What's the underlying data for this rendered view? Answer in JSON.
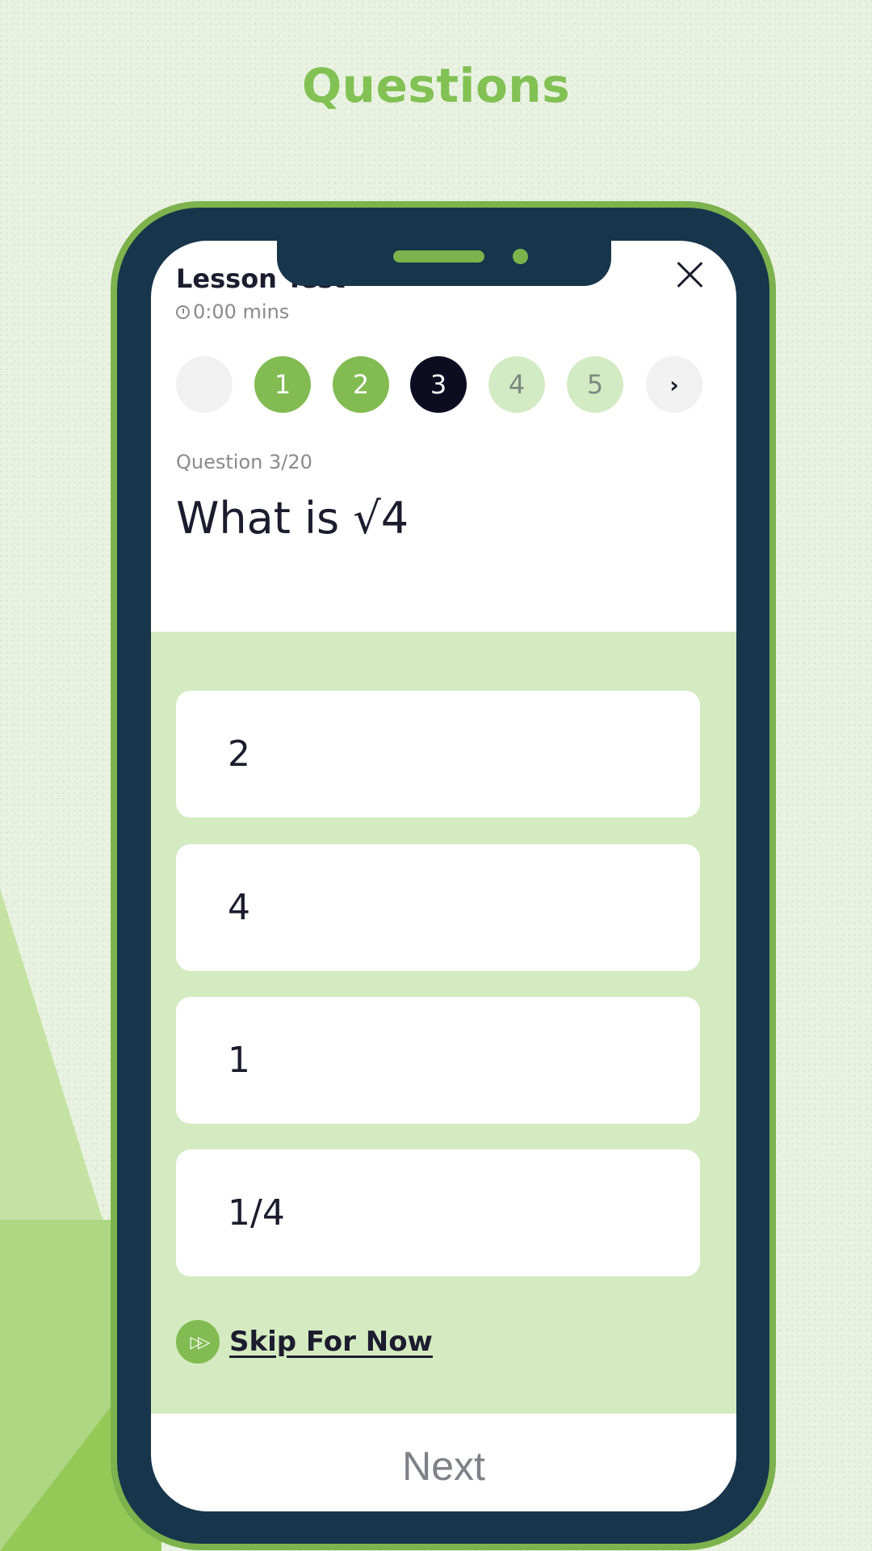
{
  "page": {
    "title": "Questions"
  },
  "colors": {
    "accent_green": "#82bb52",
    "frame_navy": "#17354b",
    "answers_bg": "#d4ebc1",
    "current_step": "#0d0d22"
  },
  "header": {
    "lesson_title": "Lesson Test",
    "timer_icon": "stopwatch-icon",
    "timer": "0:00 mins",
    "close_icon": "close-icon"
  },
  "steps": [
    {
      "label": "",
      "state": "blank"
    },
    {
      "label": "1",
      "state": "done"
    },
    {
      "label": "2",
      "state": "done"
    },
    {
      "label": "3",
      "state": "current"
    },
    {
      "label": "4",
      "state": "pending"
    },
    {
      "label": "5",
      "state": "pending"
    },
    {
      "label": "›",
      "state": "next",
      "icon": "chevron-right-icon"
    }
  ],
  "question": {
    "counter": "Question 3/20",
    "text": "What is √4"
  },
  "answers": [
    {
      "label": "2"
    },
    {
      "label": "4"
    },
    {
      "label": "1"
    },
    {
      "label": "1/4"
    }
  ],
  "skip": {
    "icon": "fast-forward-icon",
    "icon_glyph": "▷▷",
    "label": "Skip For Now"
  },
  "footer": {
    "next_label": "Next"
  }
}
